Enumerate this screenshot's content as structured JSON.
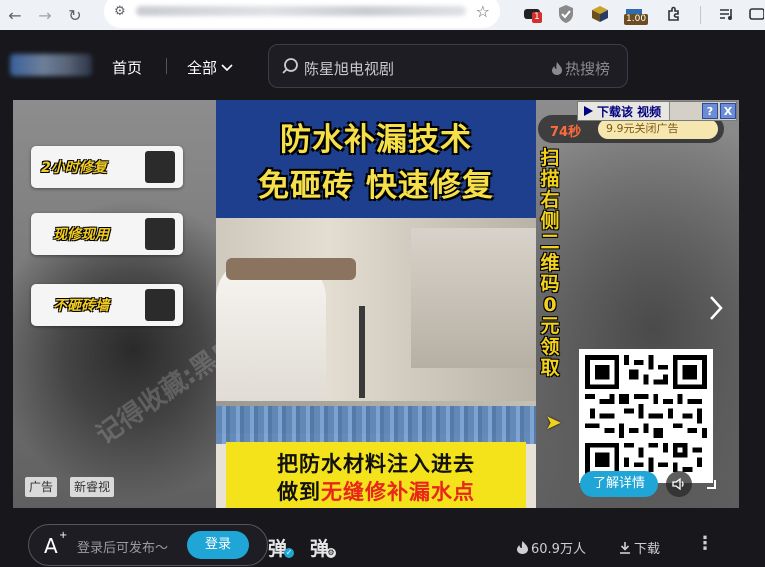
{
  "browser": {
    "back_icon": "arrow-left-icon",
    "forward_icon": "arrow-right-icon",
    "reload_icon": "reload-icon",
    "ext_badge_count": "1",
    "ext_zoom": "1.00"
  },
  "header": {
    "home": "首页",
    "all": "全部",
    "search_text": "陈星旭电视剧",
    "hot_search": "热搜榜"
  },
  "video_ad": {
    "features": [
      "2小时修复",
      "现修现用",
      "不砸砖墙"
    ],
    "title_line1": "防水补漏技术",
    "title_line2": "免砸砖 快速修复",
    "vertical_text": [
      "扫",
      "描",
      "右",
      "侧",
      "二",
      "维",
      "码",
      "0",
      "元",
      "领",
      "取"
    ],
    "bottom_line1": "把防水材料注入进去",
    "bottom_line2_black": "做到",
    "bottom_line2_red": "无缝修补漏水点",
    "countdown": "74秒",
    "close_offer": "9.9元关闭广告",
    "download_label": "下载该 视频",
    "help": "?",
    "close": "X",
    "details_button": "了解详情",
    "tag_ad": "广告",
    "tag_source": "新睿视",
    "watermark": "记得收藏:黑白"
  },
  "bottom_bar": {
    "danmu_placeholder": "登录后可发布～",
    "login": "登录",
    "dan1": "弹",
    "dan2": "弹",
    "heat": "60.9万人",
    "download": "下载",
    "more": "⋮"
  }
}
